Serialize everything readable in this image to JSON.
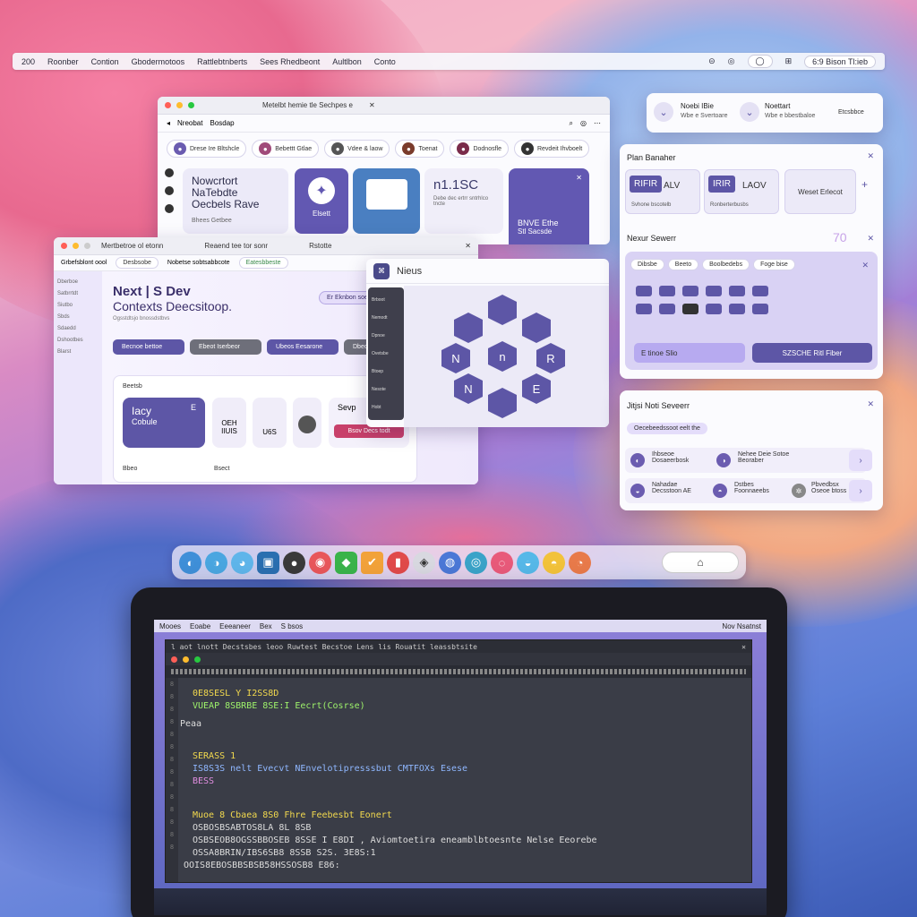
{
  "menubar": {
    "items": [
      "200",
      "Roonber",
      "Contion",
      "Gbodermotoos",
      "Rattlebtnberts",
      "Sees Rhedbeont",
      "Aultlbon",
      "Conto"
    ],
    "right_items": [
      "⊝",
      "◎",
      "◯",
      "⊞",
      "6:9 Bison Tl:ieb"
    ]
  },
  "win_top": {
    "tabs": [
      "Metelbt hemie tle Sechpes e",
      "Nreobat",
      "Bosdap"
    ],
    "chips": [
      "Drese Ire Bltshcle",
      "Bebettt Gtlae",
      "Vdee & laow",
      "Toenat",
      "Dodnosfle",
      "Revdeit Ihvboelt"
    ],
    "card1": {
      "title": "Nowcrtort NaTebdte Oecbels Rave",
      "sub": "Bhees Getbee"
    },
    "card2": {
      "label": "Elsett"
    },
    "card4": {
      "title": "n1.1SC",
      "sub": "Debe dec ertrr sntrhlco tncte"
    },
    "card5": {
      "title": "BNVE Ethe",
      "sub": "Stl Sacsde"
    }
  },
  "win_mid": {
    "tabs": [
      "Mertbetroe ol etonn",
      "Reaend tee tor sonr",
      "Rstotte"
    ],
    "chips": [
      "Grbefsblont oool",
      "Desbsobe",
      "Nobetse sobtsabbcote",
      "Eatesbbeste"
    ],
    "sidebar": [
      "Dberboe",
      "Satbrrtdt",
      "Siutbo",
      "Sbds",
      "Sdaedd",
      "Dshootbes",
      "Blarst"
    ],
    "title": "Next | S Dev",
    "subtitle": "Contexts Deecsitoop.",
    "caption": "Ogsstdtsjo bnossdstbvs",
    "top_btn": "Er Eknbon soe",
    "buttons": [
      "Becnoe bettoe",
      "Ebeot Iserbeor",
      "Ubeos Eesarone",
      "Dbecle"
    ],
    "section": "Beetsb",
    "card": {
      "title": "Iacy",
      "sub": "Cobule",
      "tag": "E"
    },
    "mini": [
      "OEH IIUIS",
      "U6S",
      "Sevp"
    ],
    "action": "Bsov Decs todt",
    "footer": [
      "Bbeo",
      "Bsect"
    ]
  },
  "win_nexus": {
    "title": "Nieus",
    "sidebar": [
      "Brboot",
      "Nemodt",
      "Dpnoe",
      "Ovetsbe",
      "Btoep",
      "Nesote",
      "Hobt"
    ],
    "nodes": [
      "N",
      "R",
      "N",
      "E",
      "n"
    ]
  },
  "panel_notif": {
    "a": {
      "title": "Noebi IBie",
      "sub": "Wbe e Svertoare"
    },
    "b": {
      "title": "Noettart",
      "sub": "Wbe e bbestbaloe"
    },
    "c": "Etcsbbce"
  },
  "panel_plan": {
    "title": "Plan Banaher",
    "tiles": [
      {
        "code": "RIFIR",
        "text": "ALV",
        "sub": "Svhone bscotelb"
      },
      {
        "code": "IRIR",
        "text": "LAOV",
        "sub": "Ronberterbusbs"
      },
      {
        "code": "",
        "text": "Weset Erlecot",
        "sub": ""
      }
    ],
    "section": "Nexur Sewerr",
    "counter": "70",
    "chips": [
      "Dibsbe",
      "Beeto",
      "Boolbedebs",
      "Foge bise"
    ],
    "btn_left": "E tinoe Slio",
    "btn_right": "SZSCHE Ritl Fiber"
  },
  "panel_server": {
    "title": "Jitjsi Noti Seveerr",
    "chip": "Oecebeedssoot eelt the",
    "rows": [
      {
        "a": "Ihbseoe Dosaeerbosk",
        "b": "Nehee Deie Sotoe Beoraber"
      },
      {
        "a": "Nahadae Decsstoon AE",
        "b": "Dstbes Foonnaeebs",
        "c": "Pbvedbsx Oseoe btoss"
      }
    ]
  },
  "dock": {
    "apps": [
      "◐",
      "◑",
      "◕",
      "▣",
      "●",
      "◉",
      "◆",
      "✔",
      "▮",
      "◈",
      "◍",
      "◎",
      "◌",
      "◒",
      "◓",
      "◔",
      "◴",
      "◵"
    ],
    "search": "⌂"
  },
  "laptop": {
    "menu": [
      "Mooes",
      "Eoabe",
      "Eeeaneer",
      "Bex",
      "S bsos"
    ],
    "menu_right": "Nov Nsatnst",
    "term_title": "l aot lnott Decstsbes leoo Ruwtest Becstoe Lens lis Rouatit leassbtsite",
    "lines": [
      {
        "text": "0E8SESL Y I2SS8D",
        "color": "#f2d94e"
      },
      {
        "text": "VUEAP 8SBRBE  8SE:I Eecrt(Cosrse)",
        "color": "#9ef26b"
      },
      {
        "text": "Peaa",
        "color": "#ddd"
      },
      {
        "text": "SERASS 1",
        "color": "#f2d94e"
      },
      {
        "text": "IS8S3S nelt Evecvt NEnvelotipresssbut CMTFOXs Esese",
        "color": "#8fb7ff"
      },
      {
        "text": "BESS",
        "color": "#e08ee0"
      },
      {
        "text": "Muoe  8 Cbaea  8S0 Fhre   Feebesbt Eonert",
        "color": "#f2d94e"
      },
      {
        "text": "OSBOSBSABTOS8LA 8L 8SB",
        "color": "#ddd"
      },
      {
        "text": "OSBSEOB8OGSSBBOSEB 8SSE I E8DI , Aviomtoetira eneamblbtoesnte Nelse Eeorebe",
        "color": "#ddd"
      },
      {
        "text": "OSSA8BRIN/IBS6SB8 8SSB S2S. 3E8S:1",
        "color": "#ddd"
      },
      {
        "text": "OOIS8EBOSBBSBSB58HSSOSB8 E86:",
        "color": "#ddd"
      }
    ]
  },
  "colors": {
    "accent": "#5b4fa8",
    "accent_light": "#e9e4fb",
    "terminal_bg": "#3a3d47"
  }
}
